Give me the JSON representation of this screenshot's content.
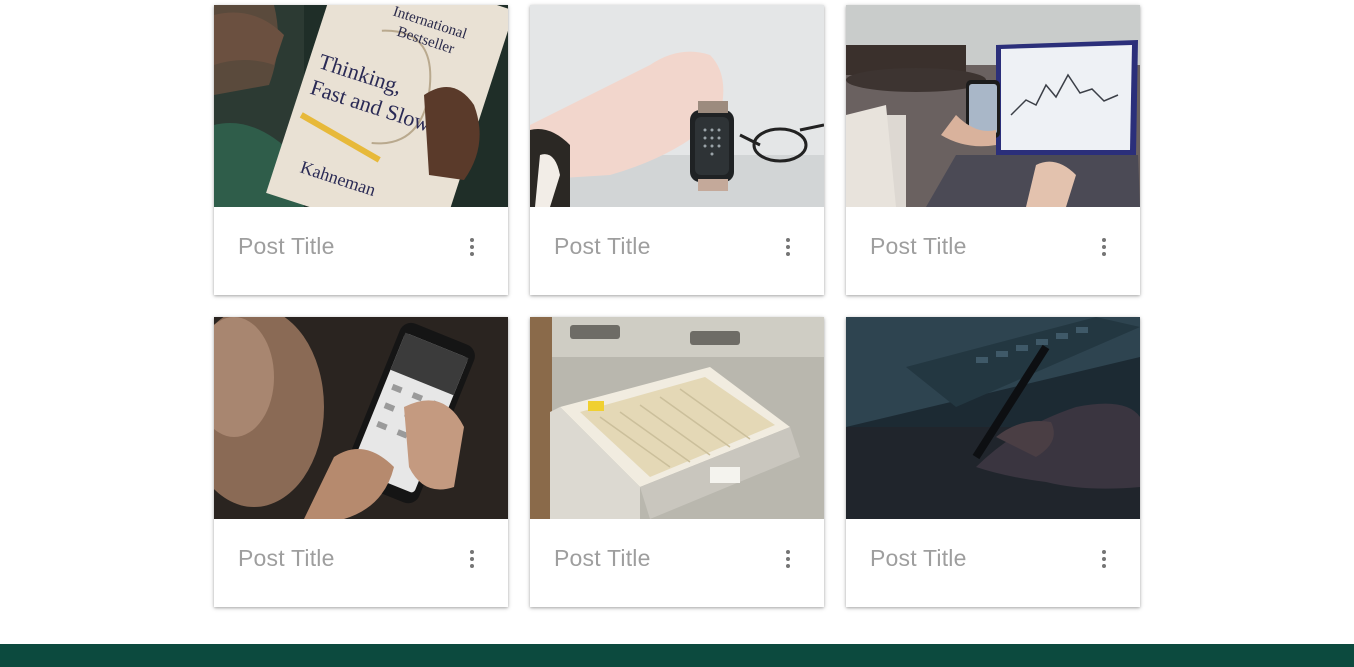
{
  "posts": [
    {
      "title": "Post Title",
      "image": "book-thinking-fast-and-slow",
      "book_text": [
        "International",
        "Bestseller",
        "Thinking,",
        "Fast and Slow",
        "Kahneman"
      ]
    },
    {
      "title": "Post Title",
      "image": "smartwatch-in-hand"
    },
    {
      "title": "Post Title",
      "image": "laptop-and-phone-charts"
    },
    {
      "title": "Post Title",
      "image": "phone-calculator-in-hands"
    },
    {
      "title": "Post Title",
      "image": "file-cabinet-drawer"
    },
    {
      "title": "Post Title",
      "image": "hand-writing-on-tablet"
    }
  ],
  "colors": {
    "title_text": "#9e9e9e",
    "menu_icon": "#757575",
    "footer": "#0c4a3e",
    "background": "#ffffff"
  },
  "icons": {
    "card_menu": "more-vert-icon"
  }
}
